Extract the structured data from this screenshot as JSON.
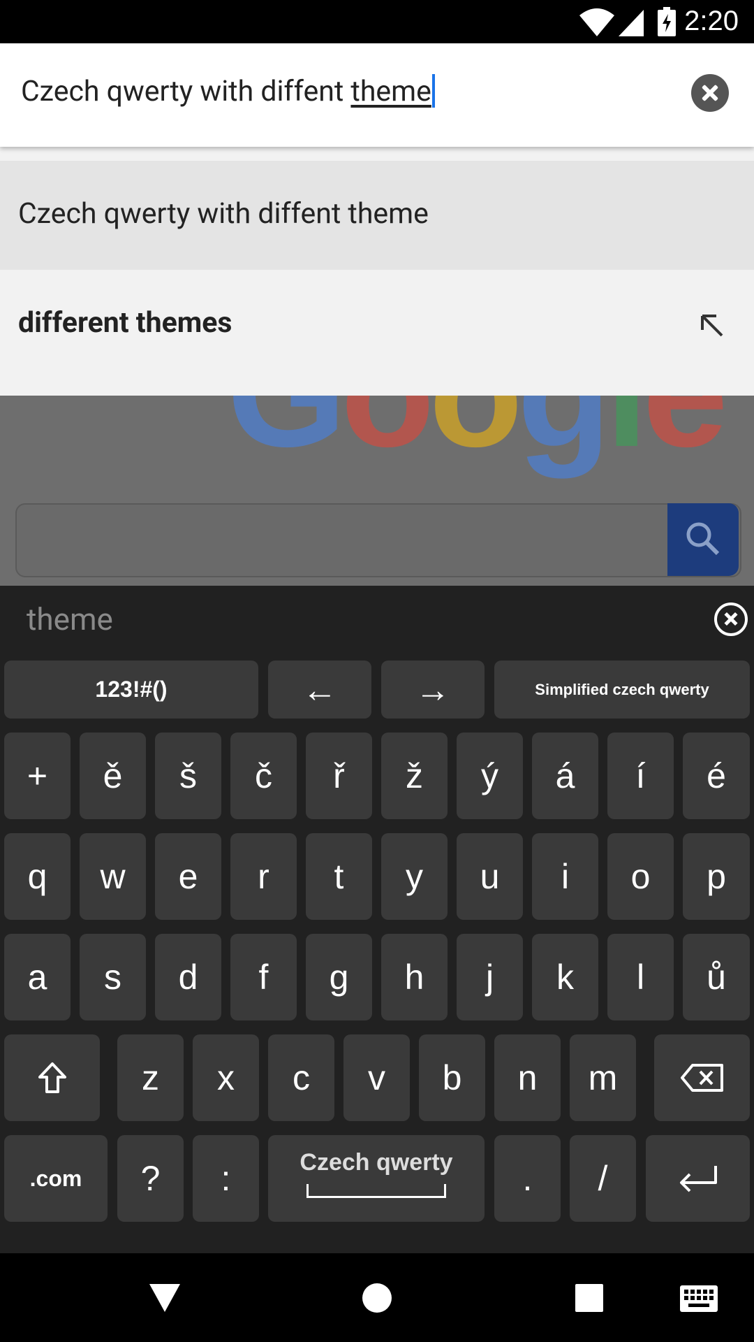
{
  "status_bar": {
    "time": "2:20"
  },
  "search": {
    "query_prefix": "Czech qwerty with diffent ",
    "query_underlined": "theme"
  },
  "suggestions": [
    {
      "text": "Czech qwerty with diffent theme"
    },
    {
      "text": "different themes"
    }
  ],
  "page": {
    "logo_text": "Google"
  },
  "keyboard": {
    "preview_word": "theme",
    "top_row": [
      "123!#()",
      "←",
      "→",
      "Simplified czech qwerty"
    ],
    "row1": [
      "+",
      "ě",
      "š",
      "č",
      "ř",
      "ž",
      "ý",
      "á",
      "í",
      "é"
    ],
    "row2": [
      "q",
      "w",
      "e",
      "r",
      "t",
      "y",
      "u",
      "i",
      "o",
      "p"
    ],
    "row3": [
      "a",
      "s",
      "d",
      "f",
      "g",
      "h",
      "j",
      "k",
      "l",
      "ů"
    ],
    "row4": [
      "z",
      "x",
      "c",
      "v",
      "b",
      "n",
      "m"
    ],
    "row5_left": [
      ".com",
      "?",
      ":"
    ],
    "space_label": "Czech qwerty",
    "row5_right": [
      ".",
      "/"
    ]
  },
  "colors": {
    "accent_blue": "#1a73e8",
    "keyboard_bg": "#212121",
    "key_bg": "#3a3a3a"
  }
}
